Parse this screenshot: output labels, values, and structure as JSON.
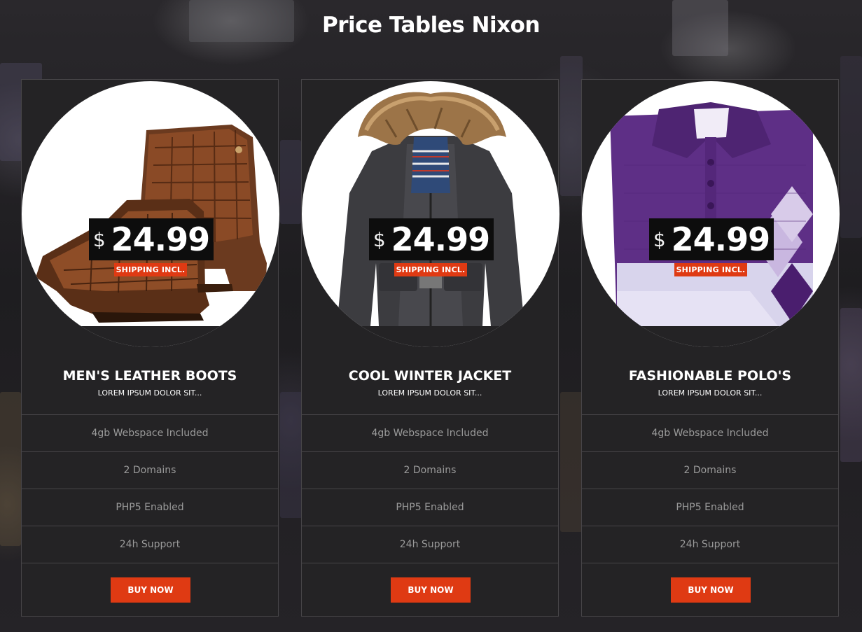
{
  "page": {
    "title": "Price Tables Nixon"
  },
  "cards": [
    {
      "image_subject": "brown leather boots",
      "currency": "$",
      "price": "24.99",
      "shipping": "SHIPPING INCL.",
      "name": "MEN'S LEATHER BOOTS",
      "subtitle": "LOREM IPSUM DOLOR SIT...",
      "features": [
        "4gb Webspace Included",
        "2 Domains",
        "PHP5 Enabled",
        "24h Support"
      ],
      "button": "BUY NOW"
    },
    {
      "image_subject": "winter jacket with fur hood",
      "currency": "$",
      "price": "24.99",
      "shipping": "SHIPPING INCL.",
      "name": "COOL WINTER JACKET",
      "subtitle": "LOREM IPSUM DOLOR SIT...",
      "features": [
        "4gb Webspace Included",
        "2 Domains",
        "PHP5 Enabled",
        "24h Support"
      ],
      "button": "BUY NOW"
    },
    {
      "image_subject": "purple argyle polo shirt",
      "currency": "$",
      "price": "24.99",
      "shipping": "SHIPPING INCL.",
      "name": "FASHIONABLE POLO'S",
      "subtitle": "LOREM IPSUM DOLOR SIT...",
      "features": [
        "4gb Webspace Included",
        "2 Domains",
        "PHP5 Enabled",
        "24h Support"
      ],
      "button": "BUY NOW"
    }
  ],
  "colors": {
    "accent": "#df3a13",
    "card_bg": "#242325",
    "card_border": "#474548",
    "feature_text": "#9a9a9a",
    "title_text": "#ffffff",
    "price_box": "#0d0d0d"
  }
}
